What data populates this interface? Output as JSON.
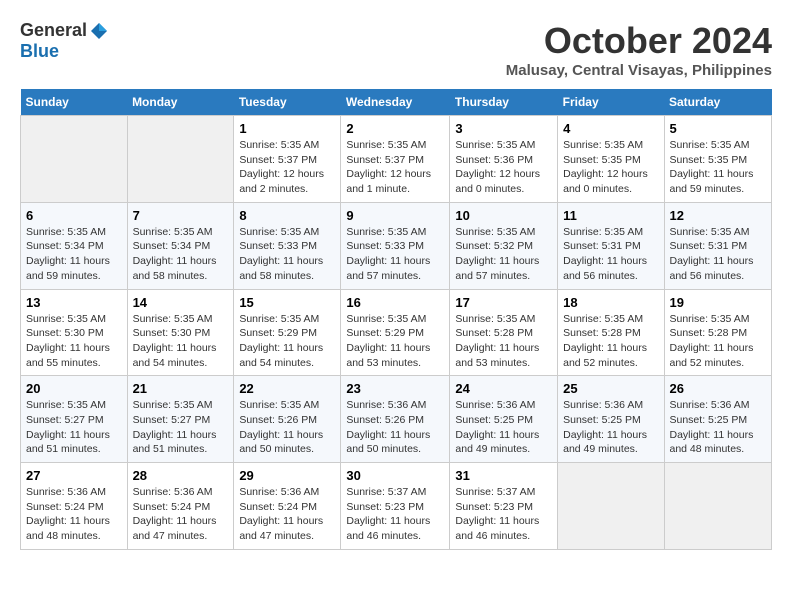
{
  "logo": {
    "general": "General",
    "blue": "Blue"
  },
  "title": "October 2024",
  "subtitle": "Malusay, Central Visayas, Philippines",
  "headers": [
    "Sunday",
    "Monday",
    "Tuesday",
    "Wednesday",
    "Thursday",
    "Friday",
    "Saturday"
  ],
  "weeks": [
    [
      {
        "day": "",
        "info": ""
      },
      {
        "day": "",
        "info": ""
      },
      {
        "day": "1",
        "info": "Sunrise: 5:35 AM\nSunset: 5:37 PM\nDaylight: 12 hours\nand 2 minutes."
      },
      {
        "day": "2",
        "info": "Sunrise: 5:35 AM\nSunset: 5:37 PM\nDaylight: 12 hours\nand 1 minute."
      },
      {
        "day": "3",
        "info": "Sunrise: 5:35 AM\nSunset: 5:36 PM\nDaylight: 12 hours\nand 0 minutes."
      },
      {
        "day": "4",
        "info": "Sunrise: 5:35 AM\nSunset: 5:35 PM\nDaylight: 12 hours\nand 0 minutes."
      },
      {
        "day": "5",
        "info": "Sunrise: 5:35 AM\nSunset: 5:35 PM\nDaylight: 11 hours\nand 59 minutes."
      }
    ],
    [
      {
        "day": "6",
        "info": "Sunrise: 5:35 AM\nSunset: 5:34 PM\nDaylight: 11 hours\nand 59 minutes."
      },
      {
        "day": "7",
        "info": "Sunrise: 5:35 AM\nSunset: 5:34 PM\nDaylight: 11 hours\nand 58 minutes."
      },
      {
        "day": "8",
        "info": "Sunrise: 5:35 AM\nSunset: 5:33 PM\nDaylight: 11 hours\nand 58 minutes."
      },
      {
        "day": "9",
        "info": "Sunrise: 5:35 AM\nSunset: 5:33 PM\nDaylight: 11 hours\nand 57 minutes."
      },
      {
        "day": "10",
        "info": "Sunrise: 5:35 AM\nSunset: 5:32 PM\nDaylight: 11 hours\nand 57 minutes."
      },
      {
        "day": "11",
        "info": "Sunrise: 5:35 AM\nSunset: 5:31 PM\nDaylight: 11 hours\nand 56 minutes."
      },
      {
        "day": "12",
        "info": "Sunrise: 5:35 AM\nSunset: 5:31 PM\nDaylight: 11 hours\nand 56 minutes."
      }
    ],
    [
      {
        "day": "13",
        "info": "Sunrise: 5:35 AM\nSunset: 5:30 PM\nDaylight: 11 hours\nand 55 minutes."
      },
      {
        "day": "14",
        "info": "Sunrise: 5:35 AM\nSunset: 5:30 PM\nDaylight: 11 hours\nand 54 minutes."
      },
      {
        "day": "15",
        "info": "Sunrise: 5:35 AM\nSunset: 5:29 PM\nDaylight: 11 hours\nand 54 minutes."
      },
      {
        "day": "16",
        "info": "Sunrise: 5:35 AM\nSunset: 5:29 PM\nDaylight: 11 hours\nand 53 minutes."
      },
      {
        "day": "17",
        "info": "Sunrise: 5:35 AM\nSunset: 5:28 PM\nDaylight: 11 hours\nand 53 minutes."
      },
      {
        "day": "18",
        "info": "Sunrise: 5:35 AM\nSunset: 5:28 PM\nDaylight: 11 hours\nand 52 minutes."
      },
      {
        "day": "19",
        "info": "Sunrise: 5:35 AM\nSunset: 5:28 PM\nDaylight: 11 hours\nand 52 minutes."
      }
    ],
    [
      {
        "day": "20",
        "info": "Sunrise: 5:35 AM\nSunset: 5:27 PM\nDaylight: 11 hours\nand 51 minutes."
      },
      {
        "day": "21",
        "info": "Sunrise: 5:35 AM\nSunset: 5:27 PM\nDaylight: 11 hours\nand 51 minutes."
      },
      {
        "day": "22",
        "info": "Sunrise: 5:35 AM\nSunset: 5:26 PM\nDaylight: 11 hours\nand 50 minutes."
      },
      {
        "day": "23",
        "info": "Sunrise: 5:36 AM\nSunset: 5:26 PM\nDaylight: 11 hours\nand 50 minutes."
      },
      {
        "day": "24",
        "info": "Sunrise: 5:36 AM\nSunset: 5:25 PM\nDaylight: 11 hours\nand 49 minutes."
      },
      {
        "day": "25",
        "info": "Sunrise: 5:36 AM\nSunset: 5:25 PM\nDaylight: 11 hours\nand 49 minutes."
      },
      {
        "day": "26",
        "info": "Sunrise: 5:36 AM\nSunset: 5:25 PM\nDaylight: 11 hours\nand 48 minutes."
      }
    ],
    [
      {
        "day": "27",
        "info": "Sunrise: 5:36 AM\nSunset: 5:24 PM\nDaylight: 11 hours\nand 48 minutes."
      },
      {
        "day": "28",
        "info": "Sunrise: 5:36 AM\nSunset: 5:24 PM\nDaylight: 11 hours\nand 47 minutes."
      },
      {
        "day": "29",
        "info": "Sunrise: 5:36 AM\nSunset: 5:24 PM\nDaylight: 11 hours\nand 47 minutes."
      },
      {
        "day": "30",
        "info": "Sunrise: 5:37 AM\nSunset: 5:23 PM\nDaylight: 11 hours\nand 46 minutes."
      },
      {
        "day": "31",
        "info": "Sunrise: 5:37 AM\nSunset: 5:23 PM\nDaylight: 11 hours\nand 46 minutes."
      },
      {
        "day": "",
        "info": ""
      },
      {
        "day": "",
        "info": ""
      }
    ]
  ]
}
